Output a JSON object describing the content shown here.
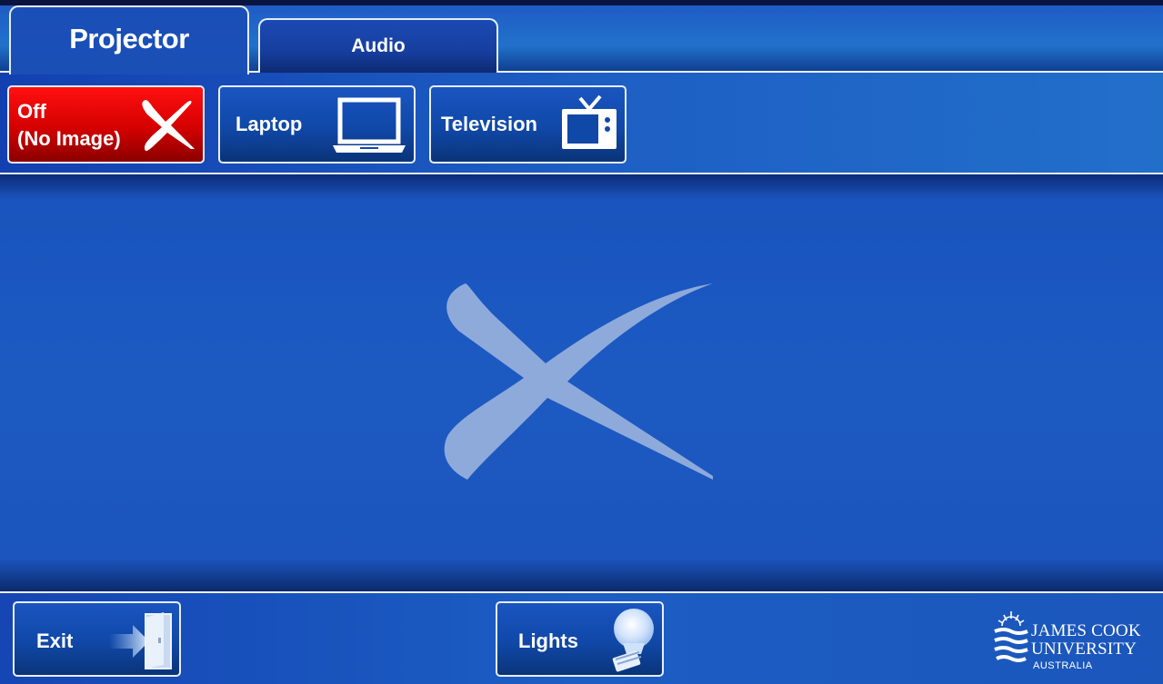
{
  "tabs": {
    "active_label": "Projector",
    "inactive_label": "Audio"
  },
  "sources": {
    "off_label_line1": "Off",
    "off_label_line2": "(No Image)",
    "laptop_label": "Laptop",
    "television_label": "Television"
  },
  "main": {
    "state_icon": "x-mark-icon"
  },
  "footer": {
    "exit_label": "Exit",
    "lights_label": "Lights"
  },
  "logo": {
    "line1": "JAMES COOK",
    "line2": "UNIVERSITY",
    "line3": "AUSTRALIA"
  },
  "colors": {
    "accent_blue": "#1b55bd",
    "off_red": "#d40000",
    "border_white": "#e8eef8"
  }
}
